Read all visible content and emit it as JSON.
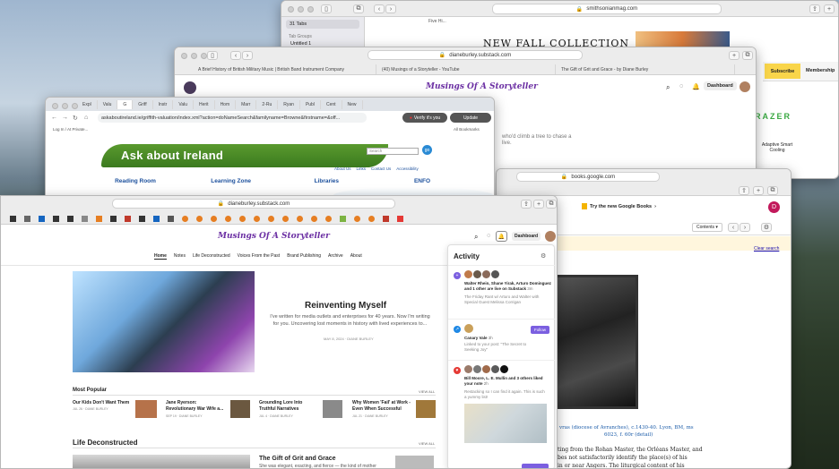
{
  "win_smithsonian": {
    "url": "smithsonianmag.com",
    "sidebar_tabs": "31 Tabs",
    "tab_groups": "Tab Groups",
    "untitled": "Untitled 1",
    "tab_label": "Five Hi...",
    "banner": "NEW FALL COLLECTION",
    "subscribe": "Subscribe",
    "membership": "Membership",
    "ad_brand": "RAZER",
    "ad_text": "Adaptive Smart Cooling"
  },
  "win_substack_back": {
    "url": "dianeburley.substack.com",
    "tabs": [
      "A Brief History of British Military Music | British Band Instrument Company",
      "(40) Musings of a Storyteller - YouTube",
      "The Gift of Grit and Grace - by Diane Burley"
    ],
    "brand": "Musings Of A Storyteller",
    "dashboard": "Dashboard",
    "text_line1": "who'd climb a tree to chase a",
    "text_line2": "live."
  },
  "win_books": {
    "url": "books.google.com",
    "try_new": "Try the new Google Books",
    "contents": "Contents",
    "avatar": "D",
    "clear_search": "Clear search",
    "caption1": "vras (diocese of Avranches), c.1430-40. Lyon, BM, ms",
    "caption2": "6023, f. 60r (detail)",
    "para1": "ting from the Rohan Master, the Orléans Master, and",
    "para2": "bes not satisfactorily identify the place(s) of his",
    "para3": "in or near Angers. The liturgical content of his"
  },
  "win_ireland": {
    "tabs": [
      "Expl",
      "Valu",
      "G",
      "Griff",
      "Instr",
      "Valu",
      "Herit",
      "Hom",
      "Marr",
      "2-Ru",
      "Ryan",
      "Publ",
      "Cent",
      "New"
    ],
    "url": "askaboutireland.ie/griffith-valuation/index.xml?action=doNameSearch&familyname=Browne&firstname=&off...",
    "verify_btn": "Verify it's you",
    "update_btn": "Update",
    "login": "Log In / At Private...",
    "bookmarks": "All Bookmarks",
    "logo": "Ask about Ireland",
    "search_placeholder": "Search",
    "toplinks": [
      "About Us",
      "Links",
      "Contact Us",
      "Accessibility"
    ],
    "nav": [
      "Reading Room",
      "Learning Zone",
      "Libraries",
      "ENFO"
    ]
  },
  "win_main": {
    "url": "dianeburley.substack.com",
    "brand": "Musings Of A Storyteller",
    "dashboard": "Dashboard",
    "nav": [
      "Home",
      "Notes",
      "Life Deconstructed",
      "Voices From the Past",
      "Brand Publishing",
      "Archive",
      "About"
    ],
    "hero_title": "Reinventing Myself",
    "hero_text": "I've written for media outlets and enterprises for 40 years. Now I'm writing for you. Uncovering lost moments in history with lived experiences to...",
    "hero_meta": "MAY 8, 2024 · DIANE BURLEY",
    "most_popular": "Most Popular",
    "view_all": "VIEW ALL",
    "popular": [
      {
        "title": "Our Kids Don't Want Them",
        "meta": "JUL 26 · DIANE BURLEY"
      },
      {
        "title": "Jane Ryerson: Revolutionary War Wife a...",
        "meta": "SEP 19 · DIANE BURLEY"
      },
      {
        "title": "Grounding Lore Into Truthful Narratives",
        "meta": "JUL 4 · DIANE BURLEY"
      },
      {
        "title": "Why Women 'Fail' at Work - Even When Successful",
        "meta": "JUL 21 · DIANE BURLEY"
      }
    ],
    "section2": "Life Deconstructed",
    "view_all2": "VIEW ALL",
    "article_title": "The Gift of Grit and Grace",
    "article_text": "She was elegant, exacting, and fierce — the kind of mother"
  },
  "activity": {
    "title": "Activity",
    "items": [
      {
        "names": "Walter Rhein, Shane Yirak, Arturo Dominguez and 1 other are live on Substack",
        "time": "3m",
        "sub": "The Friday Rant w/ Arturo and Walter with Special Guest Melissa Corrigan"
      },
      {
        "names": "Canary Vale",
        "time": "3h",
        "sub": "Linked to your post: \"The Secret to Seeking Joy\"",
        "follow": "Follow"
      },
      {
        "names": "Bill Moore, L. E. Mullin and 3 others liked your note",
        "time": "2h",
        "sub": "Restacking so I can find it again. This is such a yummy list!"
      }
    ]
  }
}
